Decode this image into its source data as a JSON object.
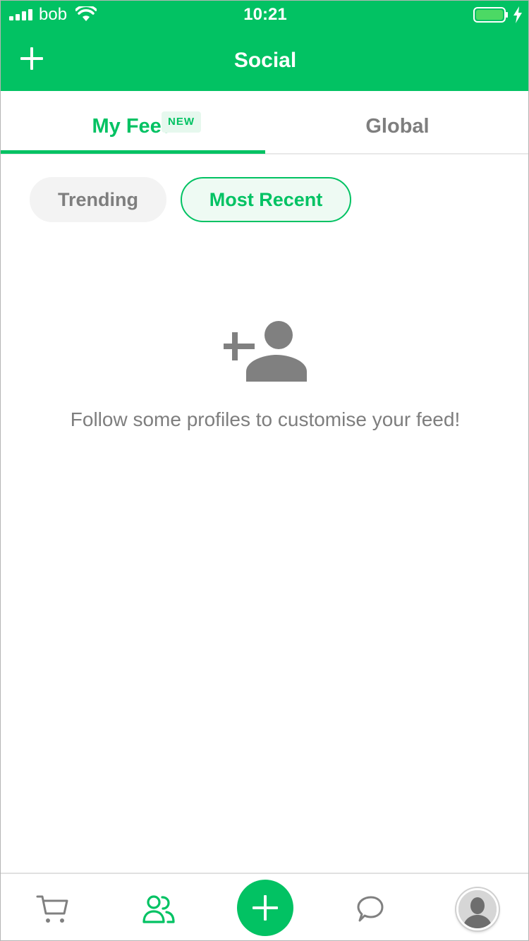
{
  "status_bar": {
    "carrier": "bob",
    "time": "10:21",
    "battery_color": "#4cd964"
  },
  "header": {
    "title": "Social",
    "background": "#02c263",
    "add_icon": "plus-icon"
  },
  "tabs": [
    {
      "label": "My Feed",
      "badge": "NEW",
      "selected": true
    },
    {
      "label": "Global",
      "selected": false
    }
  ],
  "filters": [
    {
      "label": "Trending",
      "selected": false
    },
    {
      "label": "Most Recent",
      "selected": true
    }
  ],
  "empty_state": {
    "icon": "add-person-icon",
    "message": "Follow some profiles to customise your feed!"
  },
  "bottom_nav": {
    "items": [
      {
        "icon": "cart-icon",
        "active": false
      },
      {
        "icon": "people-icon",
        "active": true
      },
      {
        "icon": "plus-icon",
        "active": false
      },
      {
        "icon": "chat-bubble-icon",
        "active": false
      },
      {
        "icon": "avatar-icon",
        "active": false
      }
    ]
  },
  "colors": {
    "accent": "#02c263",
    "muted_text": "#7e7e7e",
    "icon_gray": "#808080"
  }
}
